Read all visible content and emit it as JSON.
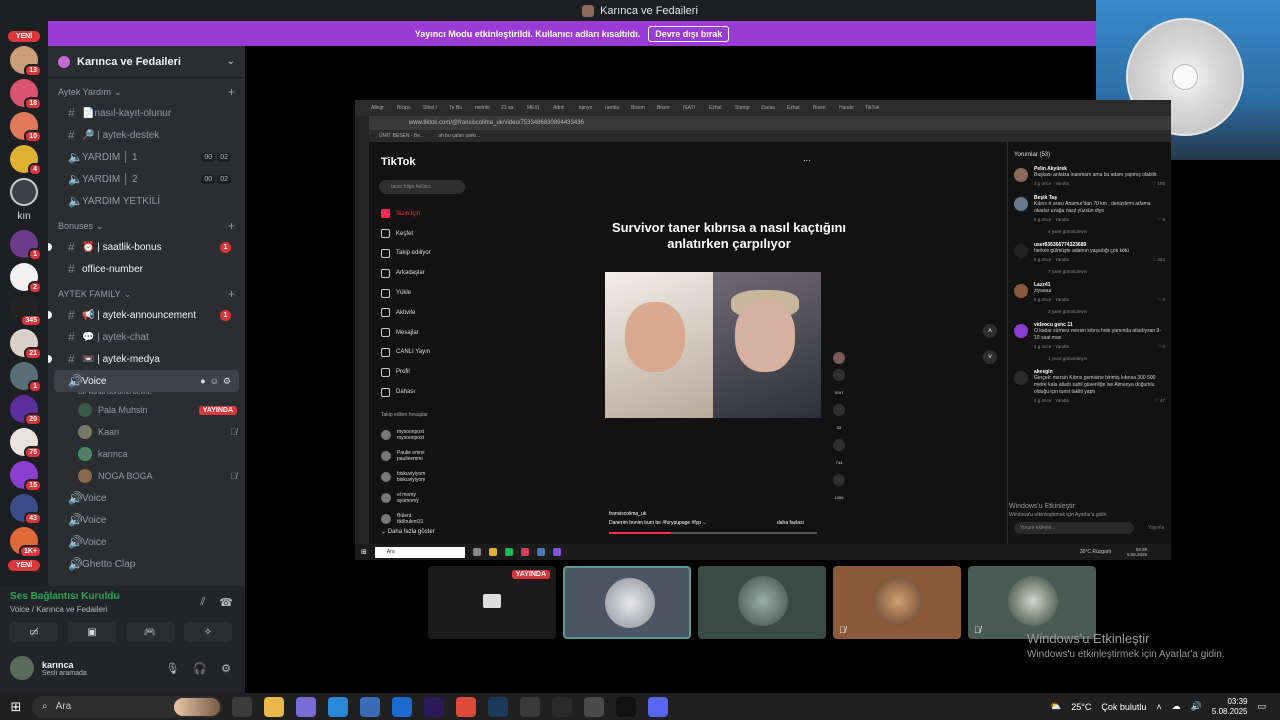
{
  "window": {
    "title": "Karınca ve Fedaileri"
  },
  "banner": {
    "text": "Yayıncı Modu etkinleştirildi. Kullanıcı adları kısaltıldı.",
    "button": "Devre dışı bırak"
  },
  "rail": {
    "new_top": "YENİ",
    "new_bottom": "YENİ",
    "text_item": "kın",
    "badges": [
      "13",
      "18",
      "10",
      "4",
      "1",
      "2",
      "345",
      "21",
      "1",
      "20",
      "75",
      "15",
      "43",
      "1K+"
    ]
  },
  "guild": {
    "name": "Karınca ve Fedaileri"
  },
  "categories": {
    "c1": "Aytek Yardım",
    "c2": "Bonuses",
    "c3": "AYTEK FAMILY"
  },
  "channels": {
    "kayit": "📄nasıl-kayıt-olunur",
    "destek": "🔎 | aytek-destek",
    "yardim1": "YARDIM │ 1",
    "yardim1_a": "00",
    "yardim1_b": "02",
    "yardim2": "YARDIM │ 2",
    "yardim2_a": "00",
    "yardim2_b": "02",
    "yetkili": "YARDIM YETKİLİ",
    "bonus": "⏰ | saatlik-bonus",
    "bonus_badge": "1",
    "office": "office-number",
    "announce": "📢 | aytek-announcement",
    "announce_badge": "1",
    "chat": "💬 | aytek-chat",
    "medya": "📼 | aytek-medya",
    "voice_active": "Voice",
    "voice_status": "Bir kanal durumu belirle",
    "voice2": "Voice",
    "voice3": "Voice",
    "voice4": "Voice",
    "ghetto": "Ghetto Clap"
  },
  "voice_users": [
    {
      "name": "Pala Muhsin",
      "live": "YAYINDA"
    },
    {
      "name": "Kaan"
    },
    {
      "name": "karınca"
    },
    {
      "name": "NOGA BOGA"
    }
  ],
  "voice_panel": {
    "status": "Ses Bağlantısı Kuruldu",
    "location": "Voice / Karınca ve Fedaileri"
  },
  "user": {
    "name": "karınca",
    "status": "Sesli aramada"
  },
  "stream": {
    "tabs": [
      "Allegr",
      "Bicipo",
      "Sibel İ",
      "7e Bü",
      "meinkr",
      "21 sa",
      "MEXİ",
      "Admi",
      "kanyo",
      "ramba",
      "Bixem",
      "Bixen",
      "|SATI",
      "Ezhal",
      "Stamp",
      "Zaeas",
      "Ezhal",
      "Bixen",
      "Hande",
      "TikTok"
    ],
    "url": "www.tiktok.com/@fransiscolima_uk/video/7533486830894433436",
    "bookmarks": [
      "ÜMİT BESEN - Be...",
      "ah bu çalan şarkı..."
    ],
    "tiktok": {
      "logo": "TikTok",
      "search": "taner bilge hellacı",
      "nav": [
        "Sizin İçin",
        "Keşfet",
        "Takip ediliyor",
        "Arkadaşlar",
        "Yükle",
        "Aktivite",
        "Mesajlar",
        "CANLI Yayın",
        "Profil",
        "Dahası"
      ],
      "following_label": "Takip edilen hesaplar",
      "following": [
        {
          "n": "mysoonpost",
          "h": "mysoonpost"
        },
        {
          "n": "Paulie emmi",
          "h": "paulieemmi"
        },
        {
          "n": "biskuviyiyom",
          "h": "biskuviyiyom"
        },
        {
          "n": "el momy",
          "h": "ayomomy"
        },
        {
          "n": "Bülent",
          "h": "tikilbulent31"
        }
      ],
      "more": "Daha fazla göster",
      "video_title": "Survivor taner kıbrısa a nasıl kaçtığını anlatırken çarpılıyor",
      "author": "fransiscolima_uk",
      "caption": "Danerim bonim bum be #foryoupage #fyp ...",
      "caption_more": "daha fazlası",
      "counts": {
        "likes": "5197",
        "comments": "53",
        "saves": "744",
        "shares": "1265"
      },
      "progress": 0.3
    },
    "comments": {
      "header": "Yorumlar (53)",
      "items": [
        {
          "u": "Pelin Akyürek",
          "t": "Başkası anlatsa inanmam ama bu adam yapmış olabilir.",
          "time": "3 g önce",
          "reply": "Yanıtla",
          "likes": "185"
        },
        {
          "u": "Beşik Taş",
          "t": "Kıbrıs tr arası Anamur'dan 70 km , denizdemi adama okadar uzağa nasıl yüzsün diye",
          "time": "5 g önce",
          "reply": "Yanıtla",
          "likes": "8",
          "more": "4 yanıt görüntüleyin"
        },
        {
          "u": "user836366774323689",
          "t": "herkes gülmüşte adamın yaşadığı çok kötü",
          "time": "5 g önce",
          "reply": "Yanıtla",
          "likes": "254",
          "more": "7 yanıt görüntüleyin"
        },
        {
          "u": "Lazz41",
          "t": "ziyaaaa",
          "time": "5 g önce",
          "reply": "Yanıtla",
          "likes": "3",
          "more": "3 yanıt görüntüleyin"
        },
        {
          "u": "videocu genc 11",
          "t": "O kadar sürmez mersin kıbrıs hole yarsında atladıysan 9-10 saat max",
          "time": "1 g önce",
          "reply": "Yanıtla",
          "likes": "0",
          "more": "1 yanıt görüntüleyin"
        },
        {
          "u": "akesgin",
          "t": "Gerçek: mersin Kıbrıs gemisine binmiş kıbrısa 300 500 metre kala atladı sahil güvenliğe ise Almanya doğumlu olduğu için turist takliti yaptı",
          "time": "4 g önce",
          "reply": "Yanıtla",
          "likes": "47"
        }
      ],
      "input": "Yorum ekleyin...",
      "post": "Yayınla"
    },
    "watermark_small_a": "Windows'u Etkinleştir",
    "watermark_small_b": "Windows'u etkinleştirmek için Ayarlar'a gidin.",
    "inner_task": {
      "search": "Ara",
      "weather": "30°C Rüzgarlı",
      "time": "03:39",
      "date": "5.08.2025"
    }
  },
  "tiles": {
    "live": "YAYINDA"
  },
  "watermark": {
    "title": "Windows'u Etkinleştir",
    "sub": "Windows'u etkinleştirmek için Ayarlar'a gidin."
  },
  "taskbar": {
    "search": "Ara",
    "weather": "25°C",
    "weather_desc": "Çok bulutlu",
    "time": "03:39",
    "date": "5.08.2025"
  }
}
